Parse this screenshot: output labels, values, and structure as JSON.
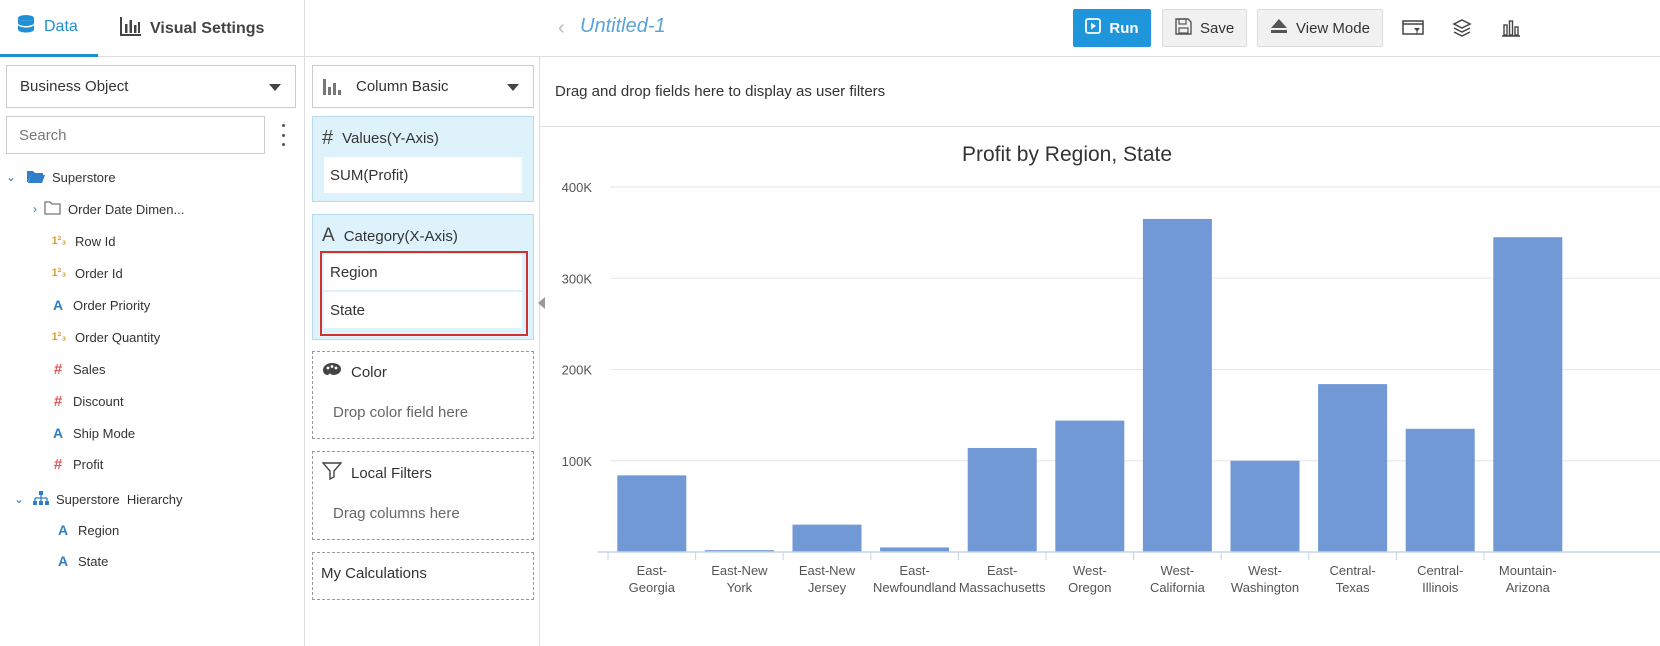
{
  "tabs": {
    "data": "Data",
    "visual_settings": "Visual Settings"
  },
  "business_object": {
    "label": "Business Object"
  },
  "search": {
    "placeholder": "Search"
  },
  "tree": {
    "root": "Superstore",
    "items": [
      {
        "label": "Order Date Dimen...",
        "type": "folder"
      },
      {
        "label": "Row Id",
        "type": "number"
      },
      {
        "label": "Order Id",
        "type": "number"
      },
      {
        "label": "Order Priority",
        "type": "text"
      },
      {
        "label": "Order Quantity",
        "type": "number"
      },
      {
        "label": "Sales",
        "type": "measure"
      },
      {
        "label": "Discount",
        "type": "measure"
      },
      {
        "label": "Ship Mode",
        "type": "text"
      },
      {
        "label": "Profit",
        "type": "measure"
      }
    ],
    "hierarchy": {
      "label": "Superstore  Hierarchy",
      "items": [
        {
          "label": "Region"
        },
        {
          "label": "State"
        }
      ]
    }
  },
  "chart_type": {
    "label": "Column Basic"
  },
  "values_zone": {
    "title": "Values(Y-Axis)",
    "fields": [
      "SUM(Profit)"
    ]
  },
  "category_zone": {
    "title": "Category(X-Axis)",
    "fields": [
      "Region",
      "State"
    ]
  },
  "color_zone": {
    "title": "Color",
    "hint": "Drop color field here"
  },
  "filters_zone": {
    "title": "Local Filters",
    "hint": "Drag columns here"
  },
  "calculations_zone": {
    "title": "My Calculations"
  },
  "topbar": {
    "title": "Untitled-1",
    "run": "Run",
    "save": "Save",
    "view_mode": "View Mode"
  },
  "filter_bar": {
    "text": "Drag and drop fields here to display as user filters"
  },
  "colors": {
    "accent": "#1f95db",
    "bar": "#7199d6",
    "highlight": "#d0332f"
  },
  "chart_data": {
    "type": "bar",
    "title": "Profit by Region, State",
    "categories": [
      "East-Georgia",
      "East-New York",
      "East-New Jersey",
      "East-Newfoundland",
      "East-Massachusetts",
      "West-Oregon",
      "West-California",
      "West-Washington",
      "Central-Texas",
      "Central-Illinois",
      "Mountain-Arizona"
    ],
    "category_lines": [
      [
        "East-",
        "Georgia"
      ],
      [
        "East-New",
        "York"
      ],
      [
        "East-New",
        "Jersey"
      ],
      [
        "East-",
        "Newfoundland"
      ],
      [
        "East-",
        "Massachusetts"
      ],
      [
        "West-",
        "Oregon"
      ],
      [
        "West-",
        "California"
      ],
      [
        "West-",
        "Washington"
      ],
      [
        "Central-",
        "Texas"
      ],
      [
        "Central-",
        "Illinois"
      ],
      [
        "Mountain-",
        "Arizona"
      ]
    ],
    "series": [
      {
        "values": [
          84000,
          2000,
          30000,
          5000,
          114000,
          144000,
          365000,
          100000,
          184000,
          135000,
          345000
        ]
      }
    ],
    "ylim": [
      0,
      400000
    ],
    "yticks": [
      "100K",
      "200K",
      "300K",
      "400K"
    ],
    "grid": true
  }
}
